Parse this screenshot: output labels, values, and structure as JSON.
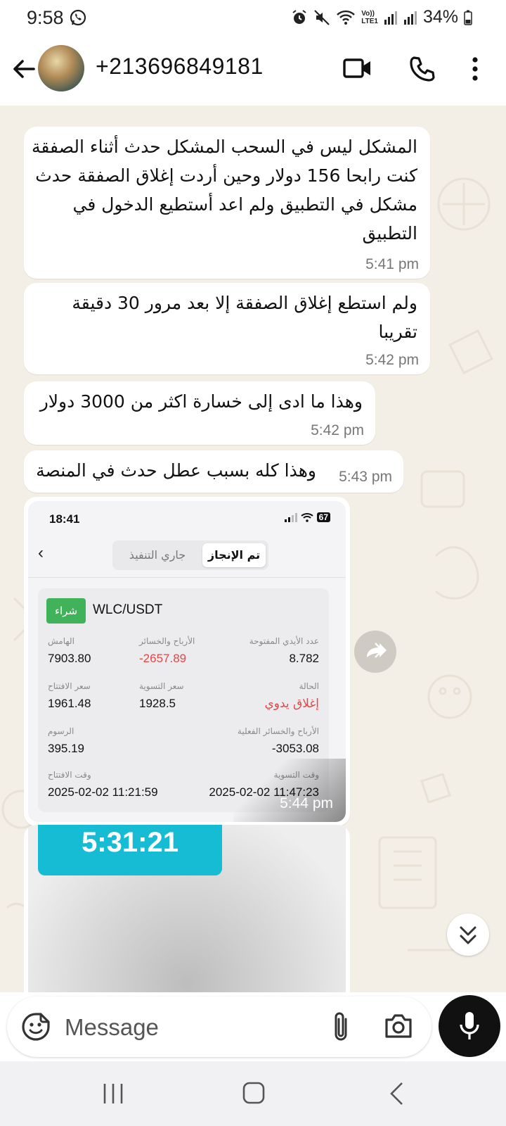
{
  "status_bar": {
    "time": "9:58",
    "network_label_top": "Vo))",
    "network_label_bottom": "LTE1",
    "battery": "34%"
  },
  "header": {
    "contact_name": "+213696849181",
    "icons": [
      "back-arrow-icon",
      "video-call-icon",
      "phone-icon",
      "more-vert-icon"
    ]
  },
  "messages": [
    {
      "text": "المشكل ليس في السحب المشكل حدث أثناء الصفقة كنت رابحا 156 دولار وحين أردت إغلاق الصفقة حدث مشكل في التطبيق ولم اعد أستطيع الدخول في التطبيق",
      "time": "5:41 pm"
    },
    {
      "text": "ولم استطع إغلاق الصفقة إلا بعد مرور 30 دقيقة تقريبا",
      "time": "5:42 pm"
    },
    {
      "text": "وهذا ما ادى إلى خسارة اكثر من 3000 دولار",
      "time": "5:42 pm"
    },
    {
      "text": "وهذا كله بسبب عطل حدث في المنصة",
      "time": "5:43 pm"
    }
  ],
  "image_message": {
    "time": "5:44 pm",
    "screenshot": {
      "clock": "18:41",
      "battery": "67",
      "tab_active": "تم الإنجاز",
      "tab_inactive": "جاري التنفيذ",
      "badge": "شراء",
      "pair": "WLC/USDT",
      "fields": {
        "margin_label": "الهامش",
        "margin_value": "7903.80",
        "pnl_label": "الأرباح والخسائر",
        "pnl_value": "-2657.89",
        "lots_label": "عدد الأيدي المفتوحة",
        "lots_value": "8.782",
        "open_price_label": "سعر الافتتاح",
        "open_price_value": "1961.48",
        "settle_price_label": "سعر التسوية",
        "settle_price_value": "1928.5",
        "status_label": "الحالة",
        "status_value": "إغلاق يدوي",
        "fees_label": "الرسوم",
        "fees_value": "395.19",
        "actual_pnl_label": "الأرباح والخسائر الفعلية",
        "actual_pnl_value": "-3053.08",
        "open_time_label": "وقت الافتتاح",
        "open_time_value": "2025-02-02 11:21:59",
        "settle_time_label": "وقت التسوية",
        "settle_time_value": "2025-02-02 11:47:23"
      }
    }
  },
  "second_image": {
    "timer_text": "5:31:21"
  },
  "composer": {
    "placeholder": "Message",
    "icons": [
      "emoji-icon",
      "attach-icon",
      "camera-icon",
      "mic-icon"
    ]
  },
  "colors": {
    "chat_bg": "#f3eee6",
    "bubble": "#ffffff",
    "buy_green": "#3fb25a",
    "loss_red": "#e04848",
    "teal": "#16bcd4"
  }
}
